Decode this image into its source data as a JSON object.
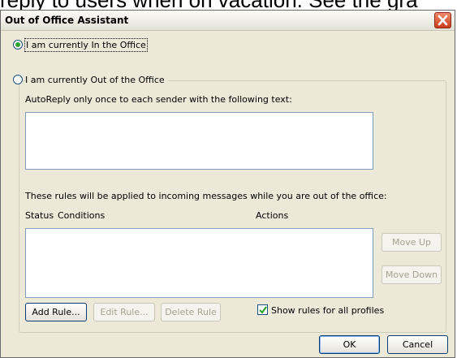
{
  "background_text": "reply to users when on vacation. See the gra",
  "dialog": {
    "title": "Out of Office Assistant",
    "close_icon": "close-icon"
  },
  "status": {
    "in_office_label": "I am currently In the Office",
    "in_office_selected": true,
    "out_office_label": "I am currently Out of the Office",
    "out_office_selected": false
  },
  "autoreply": {
    "label": "AutoReply only once to each sender with the following text:",
    "text": ""
  },
  "rules": {
    "description": "These rules will be applied to incoming messages while you are out of the office:",
    "columns": [
      "Status",
      "Conditions",
      "Actions"
    ],
    "items": [],
    "move_up_label": "Move Up",
    "move_down_label": "Move Down",
    "add_rule_label": "Add Rule...",
    "edit_rule_label": "Edit Rule...",
    "delete_rule_label": "Delete Rule",
    "show_all_profiles_label": "Show rules for all profiles",
    "show_all_profiles_checked": true
  },
  "footer": {
    "ok_label": "OK",
    "cancel_label": "Cancel"
  },
  "colors": {
    "dialog_bg": "#ece9d8",
    "radio_selected": "#2fa12f",
    "close_button": "#c93c1c"
  }
}
